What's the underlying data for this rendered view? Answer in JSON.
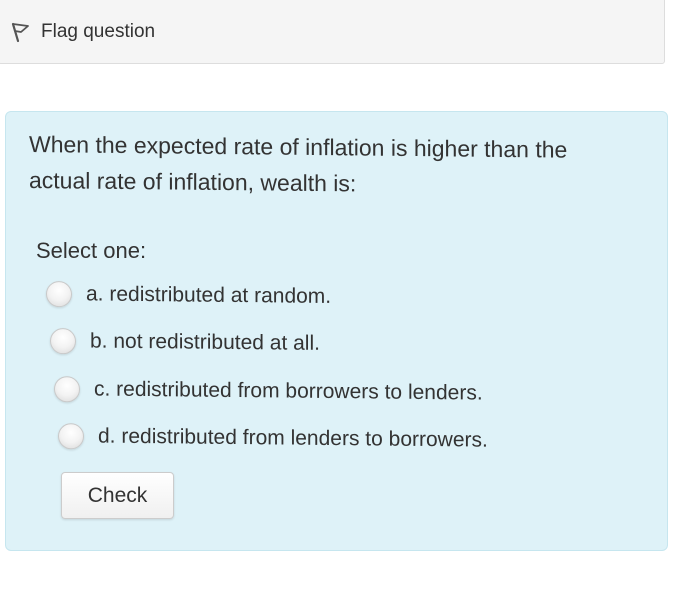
{
  "flag": {
    "icon": "flag-icon",
    "label": "Flag question"
  },
  "question": {
    "text": "When the expected rate of inflation is higher than the actual rate of inflation, wealth is:",
    "prompt": "Select one:",
    "answers": [
      {
        "label": "a. redistributed at random."
      },
      {
        "label": "b. not redistributed at all."
      },
      {
        "label": "c. redistributed from borrowers to lenders."
      },
      {
        "label": "d. redistributed from lenders to borrowers."
      }
    ],
    "check_label": "Check"
  },
  "colors": {
    "panel_background": "#def2f8",
    "panel_border": "#c6e6ef",
    "flag_bar_background": "#f5f5f5",
    "text": "#333333"
  }
}
